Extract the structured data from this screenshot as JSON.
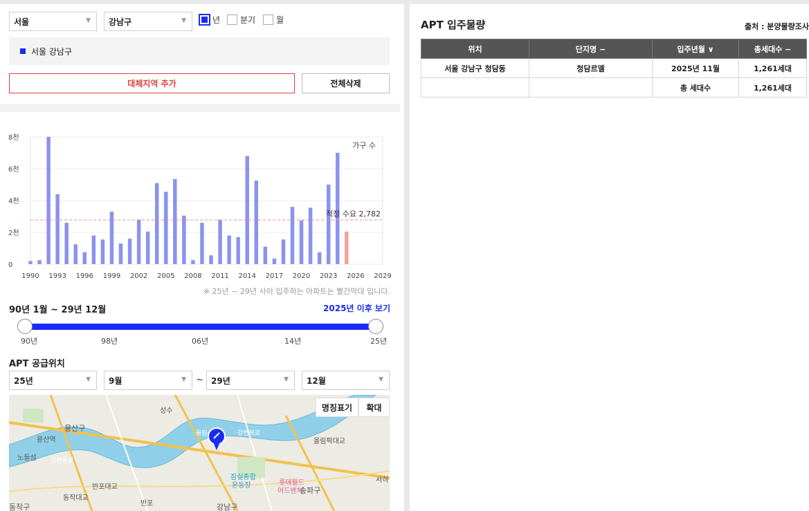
{
  "filters": {
    "city": "서울",
    "district": "강남구",
    "period_options": [
      {
        "label": "년",
        "checked": true
      },
      {
        "label": "분기",
        "checked": false
      },
      {
        "label": "월",
        "checked": false
      }
    ]
  },
  "region_list": [
    "서울 강남구"
  ],
  "buttons": {
    "add_region": "대체지역 추가",
    "delete_all": "전체삭제"
  },
  "chart_data": {
    "type": "bar",
    "series_label": "가구 수",
    "y_ticks": [
      "0",
      "2천",
      "4천",
      "6천",
      "8천"
    ],
    "x_ticks": [
      "1990",
      "1993",
      "1996",
      "1999",
      "2002",
      "2005",
      "2008",
      "2011",
      "2014",
      "2017",
      "2020",
      "2023",
      "2026",
      "2029"
    ],
    "ylim": [
      0,
      8000
    ],
    "xlim": [
      1990,
      2029
    ],
    "years": [
      1990,
      1991,
      1992,
      1993,
      1994,
      1995,
      1996,
      1997,
      1998,
      1999,
      2000,
      2001,
      2002,
      2003,
      2004,
      2005,
      2006,
      2007,
      2008,
      2009,
      2010,
      2011,
      2012,
      2013,
      2014,
      2015,
      2016,
      2017,
      2018,
      2019,
      2020,
      2021,
      2022,
      2023,
      2024,
      2025
    ],
    "values": [
      200,
      250,
      8000,
      4400,
      2600,
      1250,
      750,
      1800,
      1550,
      3300,
      1300,
      1600,
      2800,
      2050,
      5100,
      4550,
      5350,
      3050,
      250,
      2600,
      550,
      2800,
      1800,
      1700,
      6800,
      5250,
      1100,
      350,
      1550,
      3600,
      2750,
      3550,
      750,
      5000,
      7000,
      2050
    ],
    "highlight_from_year": 2025,
    "bar_color": "#8b93ee",
    "highlight_color": "#f3a29c",
    "reference_line": {
      "label": "적정 수요",
      "value": 2782,
      "value_label": "2,782",
      "color": "#f08c8c"
    }
  },
  "chart_note": "※ 25년 ~ 29년 사이 입주하는 아파트는 빨간막대 입니다.",
  "range": {
    "title": "90년 1월 ~ 29년 12월",
    "link": "2025년 이후 보기",
    "ticks": [
      "90년",
      "98년",
      "06년",
      "14년",
      "25년"
    ]
  },
  "supply": {
    "title": "APT 공급위치",
    "start_year": "25년",
    "start_month": "9월",
    "tilde": "~",
    "end_year": "29년",
    "end_month": "12월"
  },
  "map": {
    "toggle_label": "명칭표기",
    "zoom_label": "확대",
    "labels": [
      "용산구",
      "용산역",
      "노들섬",
      "강변북로",
      "반포대교",
      "동작대교",
      "반포",
      "동작구",
      "성수",
      "올림",
      "강변북로",
      "올림픽대교",
      "잠실종합운동장",
      "롯데월드어드벤처",
      "송파구",
      "강남구",
      "서하"
    ]
  },
  "table": {
    "title": "APT 입주물량",
    "source": "출처 : 분양물량조사",
    "headers": [
      "위치",
      "단지명 −",
      "입주년월 ∨",
      "총세대수 −"
    ],
    "rows": [
      [
        "서울 강남구 청담동",
        "청담르엘",
        "2025년 11월",
        "1,261세대"
      ],
      [
        "",
        "",
        "총 세대수",
        "1,261세대"
      ]
    ]
  },
  "colors": {
    "accent": "#1a2bf5",
    "danger": "#e03c3c",
    "header": "#555555"
  }
}
